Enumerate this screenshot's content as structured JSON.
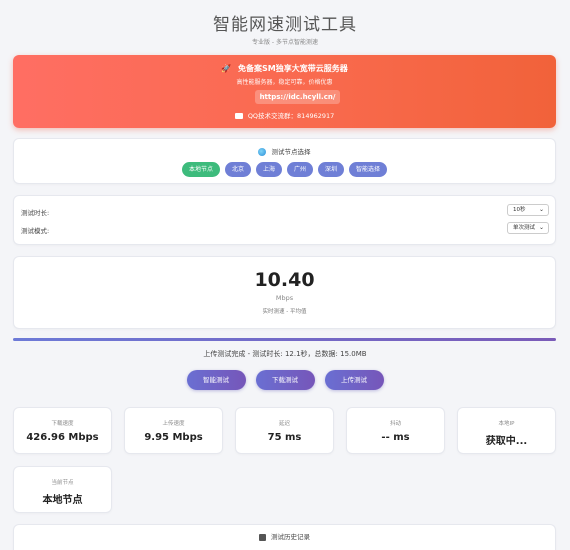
{
  "header": {
    "title": "智能网速测试工具",
    "subtitle": "专业版 - 多节点智能测速"
  },
  "promo": {
    "headline": "免备案SM独享大宽带云服务器",
    "description": "高性能服务器，稳定可靠，价格优惠",
    "link": "https://idc.hcyll.cn/",
    "qq": "QQ技术交流群：814962917",
    "icons": {
      "headline": "rocket-icon",
      "qq": "chat-icon"
    }
  },
  "nodes": {
    "title": "测试节点选择",
    "icon": "globe-icon",
    "items": [
      {
        "label": "本地节点",
        "active": true
      },
      {
        "label": "北京",
        "active": false
      },
      {
        "label": "上海",
        "active": false
      },
      {
        "label": "广州",
        "active": false
      },
      {
        "label": "深圳",
        "active": false
      },
      {
        "label": "智能选择",
        "active": false
      }
    ]
  },
  "settings": {
    "duration_label": "测试时长:",
    "duration_value": "10秒",
    "mode_label": "测试模式:",
    "mode_value": "单次测试"
  },
  "result": {
    "value": "10.40",
    "unit": "Mbps",
    "note": "实时测速 - 平均值"
  },
  "progress": {
    "fraction": 1.0
  },
  "status": "上传测试完成 - 测试时长: 12.1秒，总数据: 15.0MB",
  "actions": {
    "smart": "智能测试",
    "download": "下载测试",
    "upload": "上传测试"
  },
  "stats": [
    {
      "label": "下载速度",
      "value": "426.96 Mbps"
    },
    {
      "label": "上传速度",
      "value": "9.95 Mbps"
    },
    {
      "label": "延迟",
      "value": "75 ms"
    },
    {
      "label": "抖动",
      "value": "-- ms"
    },
    {
      "label": "本地IP",
      "value": "获取中..."
    },
    {
      "label": "当前节点",
      "value": "本地节点"
    }
  ],
  "history": {
    "title": "测试历史记录",
    "icon": "chart-icon"
  },
  "colors": {
    "promo_gradient": [
      "#ff6e63",
      "#f1623a"
    ],
    "node_button": "#6f7fd6",
    "node_active": "#3dbb7c",
    "action_gradient": [
      "#6a6fd2",
      "#7656b9"
    ]
  }
}
